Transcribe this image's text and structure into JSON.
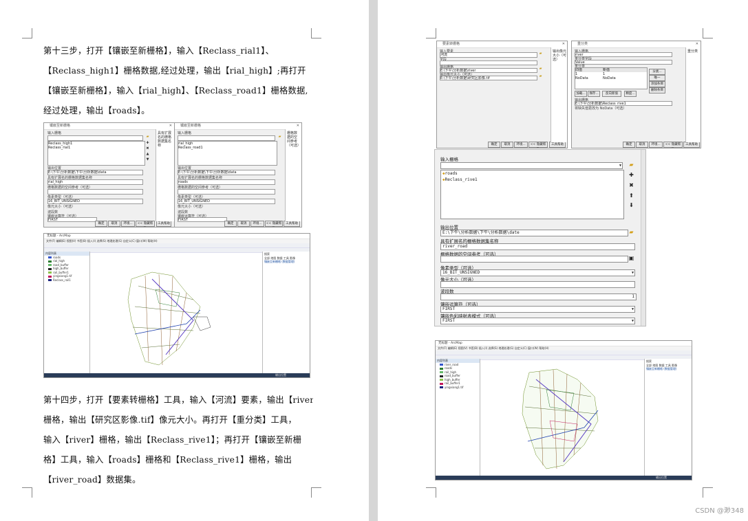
{
  "left_page": {
    "para1": [
      "第十三步，打开【镶嵌至新栅格】，输入【Reclass_rial1】、",
      "【Reclass_high1】栅格数据,经过处理，输出【rial_high】;再打开",
      "【镶嵌至新栅格】，输入【rial_high】、【Reclass_road1】栅格数据,",
      "经过处理，输出【roads】。"
    ],
    "para2": [
      "第十四步，打开【要素转栅格】工具，输入【河流】要素，输出【river】",
      "栅格，输出【研究区影像.tif】像元大小。再打开【重分类】工具，",
      "输入【river】栅格，输出【Reclass_rive1】；再打开【镶嵌至新栅",
      "格】工具，输入【roads】栅格和【Reclass_rive1】栅格，输出",
      "【river_road】数据集。"
    ],
    "dialog_a": {
      "title": "镶嵌至新栅格",
      "input_label": "输入栅格",
      "items": [
        "Reclass_high1",
        "Reclass_rial1"
      ],
      "output_label": "输出位置",
      "output_path": "E:\\下午\\分析数据\\下午\\分析数据\\data",
      "name_label": "具有扩展名的栅格数据集名称",
      "name_value": "rial_high",
      "sr_label": "栅格数据的空间参考（可选）",
      "pixel_label": "像素类型（可选）",
      "pixel_value": "16_BIT_UNSIGNED",
      "cell_label": "像元大小（可选）",
      "bands_label": "波段数",
      "mosaic_label": "镶嵌运算符（可选）",
      "mosaic_value": "FIRST",
      "colormap_label": "镶嵌色彩映射表模式（可选）",
      "colormap_value": "FIRST",
      "buttons": [
        "确定",
        "取消",
        "环境...",
        "<< 隐藏帮助",
        "工具帮助"
      ],
      "help": "具有扩展名的栅格数据集名称"
    },
    "dialog_b": {
      "title": "镶嵌至新栅格",
      "input_label": "输入栅格",
      "items": [
        "rial_high",
        "Reclass_road1"
      ],
      "output_label": "输出位置",
      "output_path": "E:\\下午\\分析数据\\下午\\分析数据\\data",
      "name_label": "具有扩展名的栅格数据集名称",
      "name_value": "roads",
      "sr_label": "栅格数据的空间参考（可选）",
      "pixel_label": "像素类型（可选）",
      "pixel_value": "16_BIT_UNSIGNED",
      "cell_label": "像元大小（可选）",
      "bands_label": "波段数",
      "mosaic_label": "镶嵌运算符（可选）",
      "mosaic_value": "FIRST",
      "colormap_label": "镶嵌色彩映射表模式（可选）",
      "colormap_value": "FIRST",
      "buttons": [
        "确定",
        "取消",
        "环境...",
        "<< 隐藏帮助",
        "工具帮助"
      ],
      "help": "栅格数据的空间参考（可选）"
    },
    "arcmap": {
      "title": "无标题 - ArcMap",
      "menu": "文件(F)  编辑(E)  视图(V)  书签(B)  插入(I)  选择(S)  地理处理(G)  自定义(C)  窗口(W)  帮助(H)",
      "toc_title": "内容列表",
      "layers": [
        "roads",
        "rial_high",
        "road_buffer",
        "high_buffer",
        "rail_buffer1",
        "yingxiang1.tif",
        "Reclass_rail1"
      ],
      "search_title": "搜索",
      "search_tabs": [
        "全部",
        "地图",
        "数据",
        "工具",
        "影像"
      ],
      "search_link": "镶嵌至新栅格 (数据管理)",
      "status": "输出位置"
    }
  },
  "right_page": {
    "dialog_c": {
      "title": "要素转栅格",
      "input_label": "输入要素",
      "input_value": "河流",
      "field_label": "字段",
      "output_label": "输出栅格",
      "output_value": "E:\\下午\\分析数据\\river",
      "cell_label": "输出像元大小（可选）",
      "cell_value": "E:\\下午\\分析数据\\研究区影像.tif",
      "buttons": [
        "确定",
        "取消",
        "环境...",
        "<< 隐藏帮助",
        "工具帮助"
      ],
      "help": "输出像元大小（可选）"
    },
    "dialog_d": {
      "title": "重分类",
      "input_label": "输入栅格",
      "input_value": "river",
      "field_label": "重分类字段",
      "field_value": "Value",
      "table_label": "重分类",
      "table_headers": [
        "旧值",
        "新值"
      ],
      "table_rows": [
        [
          "1",
          "1"
        ],
        [
          "NoData",
          "NoData"
        ]
      ],
      "side_buttons": [
        "分类...",
        "唯一",
        "添加条目",
        "删除条目"
      ],
      "bottom_buttons": [
        "加载...",
        "保存...",
        "反向新值",
        "精度..."
      ],
      "output_label": "输出栅格",
      "output_value": "E:\\下午\\分析数据\\Reclass_rive1",
      "nodata_label": "将缺失值更改为 NoData（可选）",
      "buttons": [
        "确定",
        "取消",
        "环境...",
        "<< 隐藏帮助",
        "工具帮助"
      ],
      "help": "重分类"
    },
    "mosaic_dialog": {
      "input_label": "输入栅格",
      "items": [
        "roads",
        "Reclass_rive1"
      ],
      "output_label": "输出位置",
      "output_value": "E:\\下午\\分析数据\\下午\\分析数据\\date",
      "name_label": "具有扩展名的栅格数据集名称",
      "name_value": "river_road",
      "sr_label": "栅格数据的空间参考（可选）",
      "pixel_label": "像素类型（可选）",
      "pixel_value": "16_BIT_UNSIGNED",
      "cell_label": "像元大小（可选）",
      "bands_label": "波段数",
      "bands_value": "1",
      "mosaic_label": "镶嵌运算符（可选）",
      "mosaic_value": "FIRST",
      "colormap_label": "镶嵌色彩映射表模式（可选）",
      "colormap_value": "FIRST"
    },
    "arcmap": {
      "title": "无标题 - ArcMap",
      "menu": "文件(F)  编辑(E)  视图(V)  书签(B)  插入(I)  选择(S)  地理处理(G)  自定义(C)  窗口(W)  帮助(H)",
      "toc_title": "内容列表",
      "layers": [
        "river_road",
        "roads",
        "rail_high",
        "road_buffer",
        "high_buffer",
        "rail_buffer1",
        "yingxiang1.tif"
      ],
      "search_title": "搜索",
      "search_tabs": [
        "全部",
        "地图",
        "数据",
        "工具",
        "影像"
      ],
      "search_link": "镶嵌至新栅格 (数据管理)",
      "status": "输出位置"
    }
  },
  "watermark": "CSDN @渺348",
  "colors": {
    "page": "#ffffff",
    "gutter": "#d6d6d6",
    "text": "#111111",
    "status_bar": "#2a3c58"
  }
}
